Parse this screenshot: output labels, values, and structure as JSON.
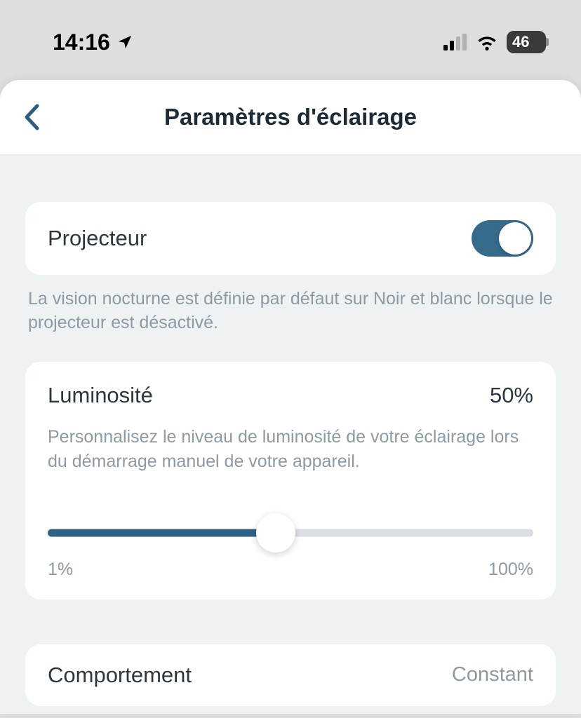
{
  "status": {
    "time": "14:16",
    "battery": "46"
  },
  "header": {
    "title": "Paramètres d'éclairage"
  },
  "projector": {
    "label": "Projecteur",
    "enabled": true,
    "help": "La vision nocturne est définie par défaut sur Noir et blanc lorsque le projecteur est désactivé."
  },
  "brightness": {
    "label": "Luminosité",
    "value": "50%",
    "description": "Personnalisez le niveau de luminosité de votre éclairage lors du démarrage manuel de votre appareil.",
    "min_label": "1%",
    "max_label": "100%",
    "position_percent": 47
  },
  "behavior": {
    "label": "Comportement",
    "value": "Constant"
  }
}
